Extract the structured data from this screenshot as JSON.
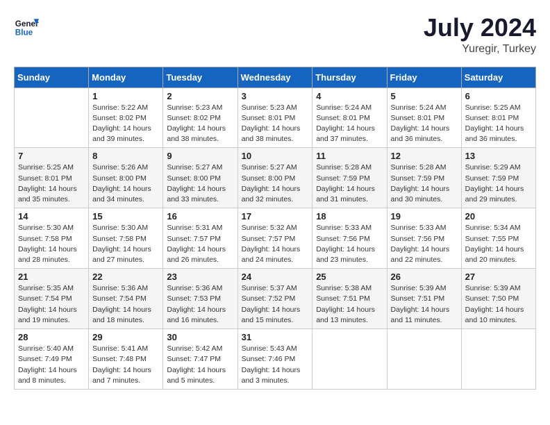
{
  "header": {
    "logo_line1": "General",
    "logo_line2": "Blue",
    "month_title": "July 2024",
    "location": "Yuregir, Turkey"
  },
  "weekdays": [
    "Sunday",
    "Monday",
    "Tuesday",
    "Wednesday",
    "Thursday",
    "Friday",
    "Saturday"
  ],
  "weeks": [
    [
      {
        "day": "",
        "info": ""
      },
      {
        "day": "1",
        "info": "Sunrise: 5:22 AM\nSunset: 8:02 PM\nDaylight: 14 hours\nand 39 minutes."
      },
      {
        "day": "2",
        "info": "Sunrise: 5:23 AM\nSunset: 8:02 PM\nDaylight: 14 hours\nand 38 minutes."
      },
      {
        "day": "3",
        "info": "Sunrise: 5:23 AM\nSunset: 8:01 PM\nDaylight: 14 hours\nand 38 minutes."
      },
      {
        "day": "4",
        "info": "Sunrise: 5:24 AM\nSunset: 8:01 PM\nDaylight: 14 hours\nand 37 minutes."
      },
      {
        "day": "5",
        "info": "Sunrise: 5:24 AM\nSunset: 8:01 PM\nDaylight: 14 hours\nand 36 minutes."
      },
      {
        "day": "6",
        "info": "Sunrise: 5:25 AM\nSunset: 8:01 PM\nDaylight: 14 hours\nand 36 minutes."
      }
    ],
    [
      {
        "day": "7",
        "info": "Sunrise: 5:25 AM\nSunset: 8:01 PM\nDaylight: 14 hours\nand 35 minutes."
      },
      {
        "day": "8",
        "info": "Sunrise: 5:26 AM\nSunset: 8:00 PM\nDaylight: 14 hours\nand 34 minutes."
      },
      {
        "day": "9",
        "info": "Sunrise: 5:27 AM\nSunset: 8:00 PM\nDaylight: 14 hours\nand 33 minutes."
      },
      {
        "day": "10",
        "info": "Sunrise: 5:27 AM\nSunset: 8:00 PM\nDaylight: 14 hours\nand 32 minutes."
      },
      {
        "day": "11",
        "info": "Sunrise: 5:28 AM\nSunset: 7:59 PM\nDaylight: 14 hours\nand 31 minutes."
      },
      {
        "day": "12",
        "info": "Sunrise: 5:28 AM\nSunset: 7:59 PM\nDaylight: 14 hours\nand 30 minutes."
      },
      {
        "day": "13",
        "info": "Sunrise: 5:29 AM\nSunset: 7:59 PM\nDaylight: 14 hours\nand 29 minutes."
      }
    ],
    [
      {
        "day": "14",
        "info": "Sunrise: 5:30 AM\nSunset: 7:58 PM\nDaylight: 14 hours\nand 28 minutes."
      },
      {
        "day": "15",
        "info": "Sunrise: 5:30 AM\nSunset: 7:58 PM\nDaylight: 14 hours\nand 27 minutes."
      },
      {
        "day": "16",
        "info": "Sunrise: 5:31 AM\nSunset: 7:57 PM\nDaylight: 14 hours\nand 26 minutes."
      },
      {
        "day": "17",
        "info": "Sunrise: 5:32 AM\nSunset: 7:57 PM\nDaylight: 14 hours\nand 24 minutes."
      },
      {
        "day": "18",
        "info": "Sunrise: 5:33 AM\nSunset: 7:56 PM\nDaylight: 14 hours\nand 23 minutes."
      },
      {
        "day": "19",
        "info": "Sunrise: 5:33 AM\nSunset: 7:56 PM\nDaylight: 14 hours\nand 22 minutes."
      },
      {
        "day": "20",
        "info": "Sunrise: 5:34 AM\nSunset: 7:55 PM\nDaylight: 14 hours\nand 20 minutes."
      }
    ],
    [
      {
        "day": "21",
        "info": "Sunrise: 5:35 AM\nSunset: 7:54 PM\nDaylight: 14 hours\nand 19 minutes."
      },
      {
        "day": "22",
        "info": "Sunrise: 5:36 AM\nSunset: 7:54 PM\nDaylight: 14 hours\nand 18 minutes."
      },
      {
        "day": "23",
        "info": "Sunrise: 5:36 AM\nSunset: 7:53 PM\nDaylight: 14 hours\nand 16 minutes."
      },
      {
        "day": "24",
        "info": "Sunrise: 5:37 AM\nSunset: 7:52 PM\nDaylight: 14 hours\nand 15 minutes."
      },
      {
        "day": "25",
        "info": "Sunrise: 5:38 AM\nSunset: 7:51 PM\nDaylight: 14 hours\nand 13 minutes."
      },
      {
        "day": "26",
        "info": "Sunrise: 5:39 AM\nSunset: 7:51 PM\nDaylight: 14 hours\nand 11 minutes."
      },
      {
        "day": "27",
        "info": "Sunrise: 5:39 AM\nSunset: 7:50 PM\nDaylight: 14 hours\nand 10 minutes."
      }
    ],
    [
      {
        "day": "28",
        "info": "Sunrise: 5:40 AM\nSunset: 7:49 PM\nDaylight: 14 hours\nand 8 minutes."
      },
      {
        "day": "29",
        "info": "Sunrise: 5:41 AM\nSunset: 7:48 PM\nDaylight: 14 hours\nand 7 minutes."
      },
      {
        "day": "30",
        "info": "Sunrise: 5:42 AM\nSunset: 7:47 PM\nDaylight: 14 hours\nand 5 minutes."
      },
      {
        "day": "31",
        "info": "Sunrise: 5:43 AM\nSunset: 7:46 PM\nDaylight: 14 hours\nand 3 minutes."
      },
      {
        "day": "",
        "info": ""
      },
      {
        "day": "",
        "info": ""
      },
      {
        "day": "",
        "info": ""
      }
    ]
  ]
}
